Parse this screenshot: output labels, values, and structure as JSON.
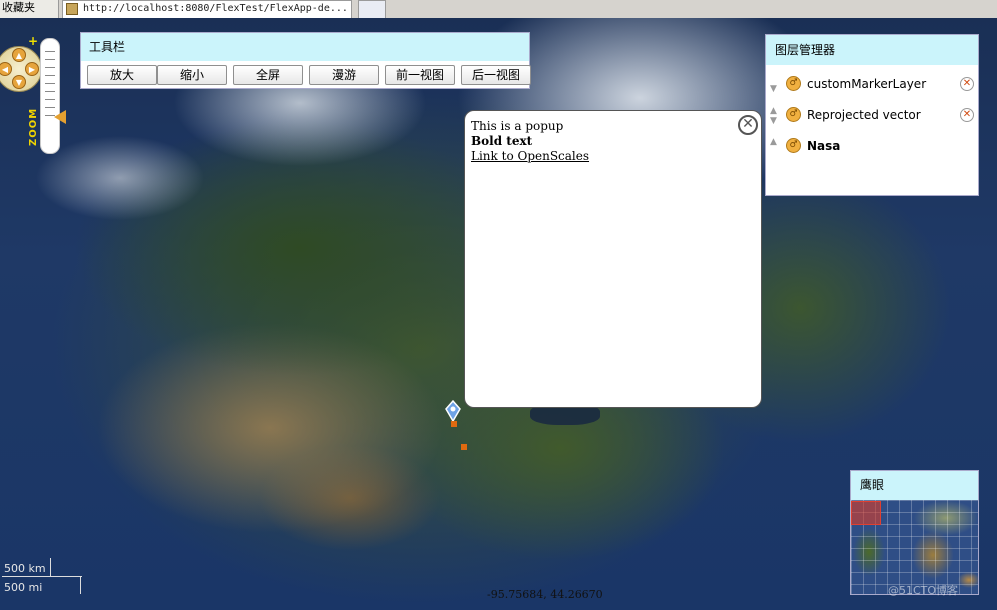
{
  "browser": {
    "favorites_tab": "收藏夹",
    "url_tab": "http://localhost:8080/FlexTest/FlexApp-de..."
  },
  "nav": {
    "zoom_plus": "+",
    "zoom_label": "ZOOM",
    "zoom_minus": "-"
  },
  "toolbar": {
    "title": "工具栏",
    "buttons": [
      "放大",
      "缩小",
      "全屏",
      "漫游",
      "前一视图",
      "后一视图"
    ]
  },
  "popup": {
    "line1": "This is a popup",
    "line2": "Bold text",
    "link": "Link to OpenScales"
  },
  "layer_manager": {
    "title": "图层管理器",
    "layers": [
      {
        "name": "customMarkerLayer",
        "bold": false,
        "removable": true
      },
      {
        "name": "Reprojected vector",
        "bold": false,
        "removable": true
      },
      {
        "name": "Nasa",
        "bold": true,
        "removable": false
      }
    ]
  },
  "overview": {
    "title": "鹰眼",
    "watermark": "@51CTO博客"
  },
  "scale": {
    "km": "500 km",
    "mi": "500 mi"
  },
  "coordinates": "-95.75684, 44.26670",
  "colors": {
    "panel_header": "#cbf4fb",
    "marker": "#e06a10"
  }
}
